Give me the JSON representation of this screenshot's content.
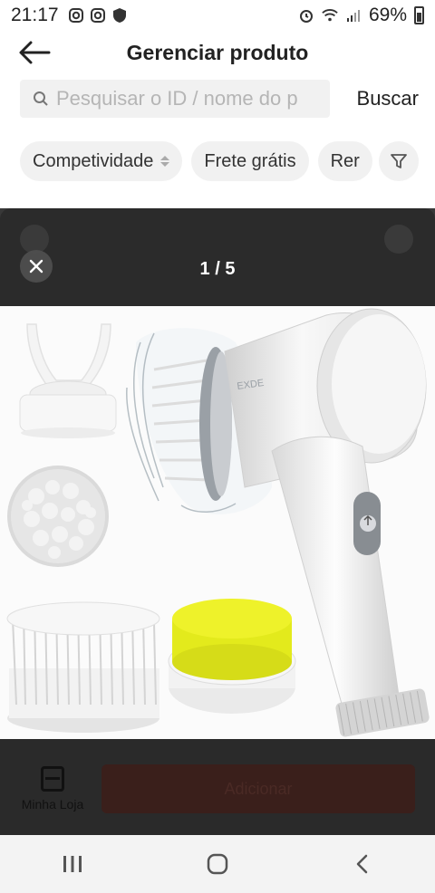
{
  "status_bar": {
    "time": "21:17",
    "battery": "69%"
  },
  "header": {
    "title": "Gerenciar produto"
  },
  "search": {
    "placeholder": "Pesquisar o ID / nome do p",
    "button_label": "Buscar"
  },
  "filters": {
    "chips": [
      {
        "label": "Competividade"
      },
      {
        "label": "Frete grátis"
      },
      {
        "label": "Rer"
      }
    ]
  },
  "viewer": {
    "counter": "1 / 5",
    "brand_text": "EXDE"
  },
  "bottom_bar": {
    "my_store_label": "Minha Loja",
    "primary_button_label": "Adicionar"
  },
  "colors": {
    "overlay": "#000000",
    "sponge_yellow": "#e8f01e",
    "accent_button": "#ee4d2d"
  }
}
